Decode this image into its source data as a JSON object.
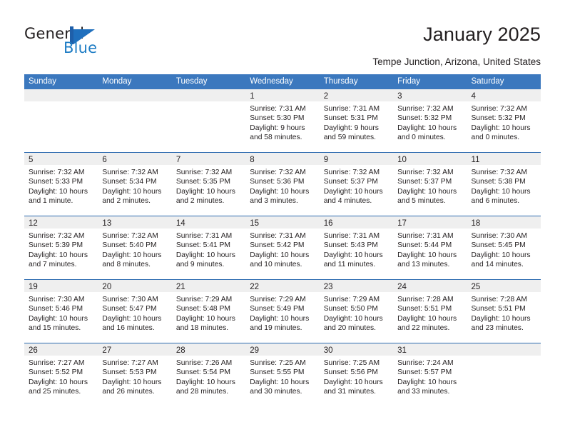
{
  "brand": {
    "name_part1": "General",
    "name_part2": "Blue",
    "logo_icon": "sail-triangle-logo",
    "blue": "#1d7cc4"
  },
  "header": {
    "title": "January 2025",
    "subtitle": "Tempe Junction, Arizona, United States"
  },
  "theme": {
    "header_blue": "#3b78be",
    "separator_blue": "#2d6bb0",
    "daynum_band": "#efefef"
  },
  "calendar": {
    "weekdays": [
      "Sunday",
      "Monday",
      "Tuesday",
      "Wednesday",
      "Thursday",
      "Friday",
      "Saturday"
    ],
    "weeks": [
      [
        {
          "day": "",
          "empty": true
        },
        {
          "day": "",
          "empty": true
        },
        {
          "day": "",
          "empty": true
        },
        {
          "day": "1",
          "sunrise": "Sunrise: 7:31 AM",
          "sunset": "Sunset: 5:30 PM",
          "daylight": "Daylight: 9 hours and 58 minutes."
        },
        {
          "day": "2",
          "sunrise": "Sunrise: 7:31 AM",
          "sunset": "Sunset: 5:31 PM",
          "daylight": "Daylight: 9 hours and 59 minutes."
        },
        {
          "day": "3",
          "sunrise": "Sunrise: 7:32 AM",
          "sunset": "Sunset: 5:32 PM",
          "daylight": "Daylight: 10 hours and 0 minutes."
        },
        {
          "day": "4",
          "sunrise": "Sunrise: 7:32 AM",
          "sunset": "Sunset: 5:32 PM",
          "daylight": "Daylight: 10 hours and 0 minutes."
        }
      ],
      [
        {
          "day": "5",
          "sunrise": "Sunrise: 7:32 AM",
          "sunset": "Sunset: 5:33 PM",
          "daylight": "Daylight: 10 hours and 1 minute."
        },
        {
          "day": "6",
          "sunrise": "Sunrise: 7:32 AM",
          "sunset": "Sunset: 5:34 PM",
          "daylight": "Daylight: 10 hours and 2 minutes."
        },
        {
          "day": "7",
          "sunrise": "Sunrise: 7:32 AM",
          "sunset": "Sunset: 5:35 PM",
          "daylight": "Daylight: 10 hours and 2 minutes."
        },
        {
          "day": "8",
          "sunrise": "Sunrise: 7:32 AM",
          "sunset": "Sunset: 5:36 PM",
          "daylight": "Daylight: 10 hours and 3 minutes."
        },
        {
          "day": "9",
          "sunrise": "Sunrise: 7:32 AM",
          "sunset": "Sunset: 5:37 PM",
          "daylight": "Daylight: 10 hours and 4 minutes."
        },
        {
          "day": "10",
          "sunrise": "Sunrise: 7:32 AM",
          "sunset": "Sunset: 5:37 PM",
          "daylight": "Daylight: 10 hours and 5 minutes."
        },
        {
          "day": "11",
          "sunrise": "Sunrise: 7:32 AM",
          "sunset": "Sunset: 5:38 PM",
          "daylight": "Daylight: 10 hours and 6 minutes."
        }
      ],
      [
        {
          "day": "12",
          "sunrise": "Sunrise: 7:32 AM",
          "sunset": "Sunset: 5:39 PM",
          "daylight": "Daylight: 10 hours and 7 minutes."
        },
        {
          "day": "13",
          "sunrise": "Sunrise: 7:32 AM",
          "sunset": "Sunset: 5:40 PM",
          "daylight": "Daylight: 10 hours and 8 minutes."
        },
        {
          "day": "14",
          "sunrise": "Sunrise: 7:31 AM",
          "sunset": "Sunset: 5:41 PM",
          "daylight": "Daylight: 10 hours and 9 minutes."
        },
        {
          "day": "15",
          "sunrise": "Sunrise: 7:31 AM",
          "sunset": "Sunset: 5:42 PM",
          "daylight": "Daylight: 10 hours and 10 minutes."
        },
        {
          "day": "16",
          "sunrise": "Sunrise: 7:31 AM",
          "sunset": "Sunset: 5:43 PM",
          "daylight": "Daylight: 10 hours and 11 minutes."
        },
        {
          "day": "17",
          "sunrise": "Sunrise: 7:31 AM",
          "sunset": "Sunset: 5:44 PM",
          "daylight": "Daylight: 10 hours and 13 minutes."
        },
        {
          "day": "18",
          "sunrise": "Sunrise: 7:30 AM",
          "sunset": "Sunset: 5:45 PM",
          "daylight": "Daylight: 10 hours and 14 minutes."
        }
      ],
      [
        {
          "day": "19",
          "sunrise": "Sunrise: 7:30 AM",
          "sunset": "Sunset: 5:46 PM",
          "daylight": "Daylight: 10 hours and 15 minutes."
        },
        {
          "day": "20",
          "sunrise": "Sunrise: 7:30 AM",
          "sunset": "Sunset: 5:47 PM",
          "daylight": "Daylight: 10 hours and 16 minutes."
        },
        {
          "day": "21",
          "sunrise": "Sunrise: 7:29 AM",
          "sunset": "Sunset: 5:48 PM",
          "daylight": "Daylight: 10 hours and 18 minutes."
        },
        {
          "day": "22",
          "sunrise": "Sunrise: 7:29 AM",
          "sunset": "Sunset: 5:49 PM",
          "daylight": "Daylight: 10 hours and 19 minutes."
        },
        {
          "day": "23",
          "sunrise": "Sunrise: 7:29 AM",
          "sunset": "Sunset: 5:50 PM",
          "daylight": "Daylight: 10 hours and 20 minutes."
        },
        {
          "day": "24",
          "sunrise": "Sunrise: 7:28 AM",
          "sunset": "Sunset: 5:51 PM",
          "daylight": "Daylight: 10 hours and 22 minutes."
        },
        {
          "day": "25",
          "sunrise": "Sunrise: 7:28 AM",
          "sunset": "Sunset: 5:51 PM",
          "daylight": "Daylight: 10 hours and 23 minutes."
        }
      ],
      [
        {
          "day": "26",
          "sunrise": "Sunrise: 7:27 AM",
          "sunset": "Sunset: 5:52 PM",
          "daylight": "Daylight: 10 hours and 25 minutes."
        },
        {
          "day": "27",
          "sunrise": "Sunrise: 7:27 AM",
          "sunset": "Sunset: 5:53 PM",
          "daylight": "Daylight: 10 hours and 26 minutes."
        },
        {
          "day": "28",
          "sunrise": "Sunrise: 7:26 AM",
          "sunset": "Sunset: 5:54 PM",
          "daylight": "Daylight: 10 hours and 28 minutes."
        },
        {
          "day": "29",
          "sunrise": "Sunrise: 7:25 AM",
          "sunset": "Sunset: 5:55 PM",
          "daylight": "Daylight: 10 hours and 30 minutes."
        },
        {
          "day": "30",
          "sunrise": "Sunrise: 7:25 AM",
          "sunset": "Sunset: 5:56 PM",
          "daylight": "Daylight: 10 hours and 31 minutes."
        },
        {
          "day": "31",
          "sunrise": "Sunrise: 7:24 AM",
          "sunset": "Sunset: 5:57 PM",
          "daylight": "Daylight: 10 hours and 33 minutes."
        },
        {
          "day": "",
          "empty": true
        }
      ]
    ]
  }
}
